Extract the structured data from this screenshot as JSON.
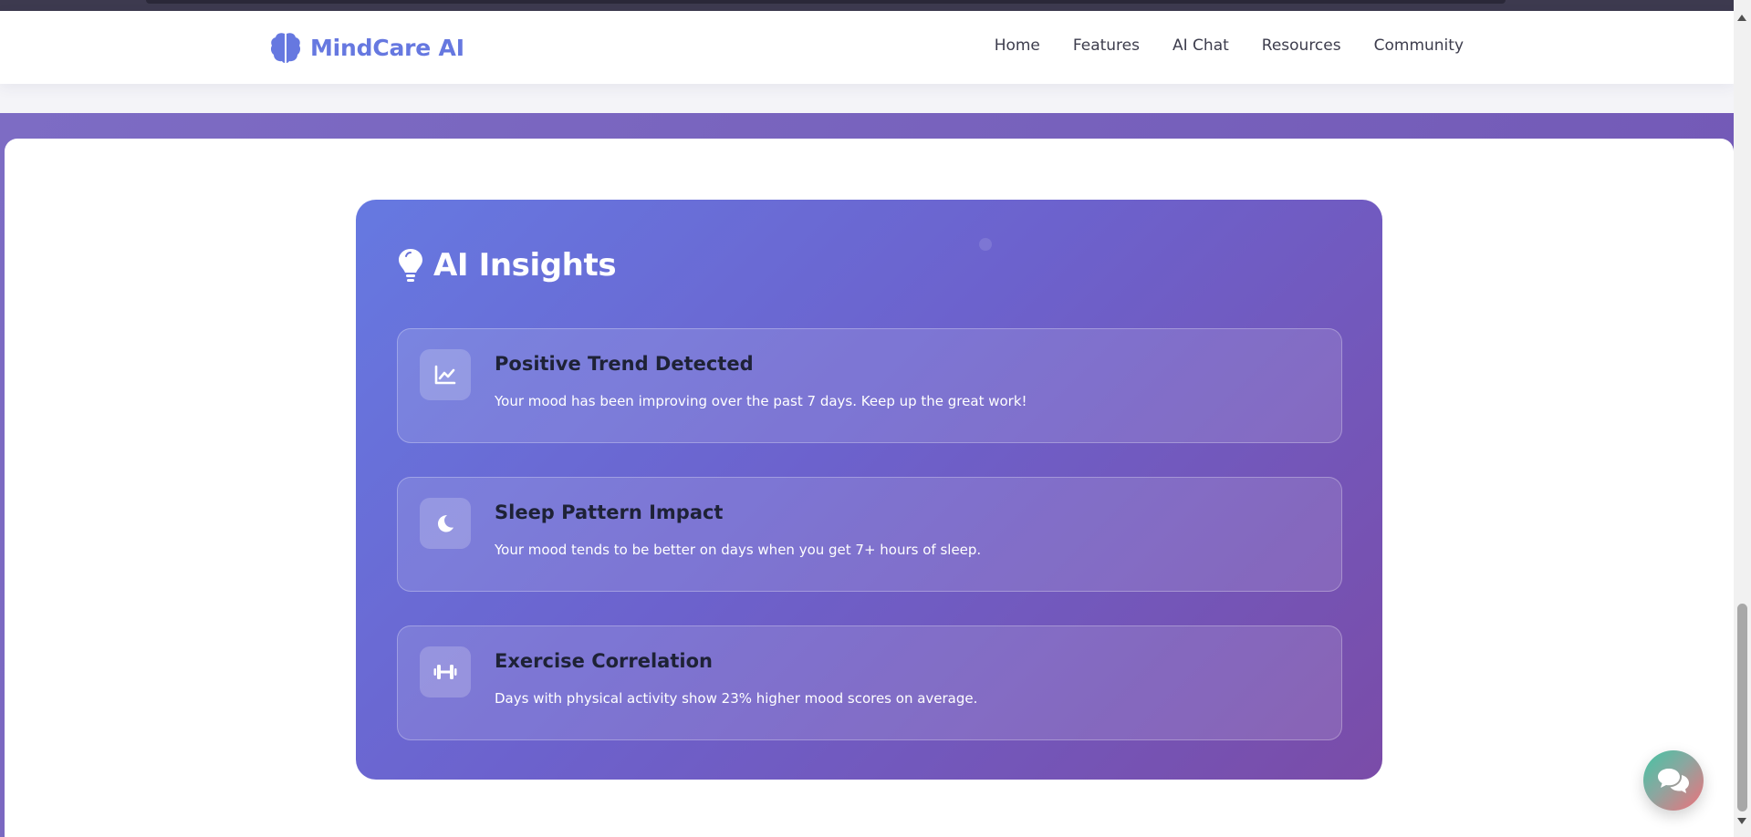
{
  "brand": {
    "name": "MindCare AI",
    "icon": "brain-icon",
    "color": "#6678e0"
  },
  "nav": {
    "links": [
      "Home",
      "Features",
      "AI Chat",
      "Resources",
      "Community"
    ]
  },
  "insights": {
    "title": "AI Insights",
    "icon": "lightbulb-icon",
    "items": [
      {
        "icon": "chart-line-icon",
        "title": "Positive Trend Detected",
        "description": "Your mood has been improving over the past 7 days. Keep up the great work!"
      },
      {
        "icon": "moon-icon",
        "title": "Sleep Pattern Impact",
        "description": "Your mood tends to be better on days when you get 7+ hours of sleep."
      },
      {
        "icon": "dumbbell-icon",
        "title": "Exercise Correlation",
        "description": "Days with physical activity show 23% higher mood scores on average."
      }
    ]
  },
  "chat_button": {
    "icon": "comments-icon"
  },
  "colors": {
    "card_gradient_start": "#6679e1",
    "card_gradient_end": "#7a4ca8",
    "band": "#7156b4"
  }
}
